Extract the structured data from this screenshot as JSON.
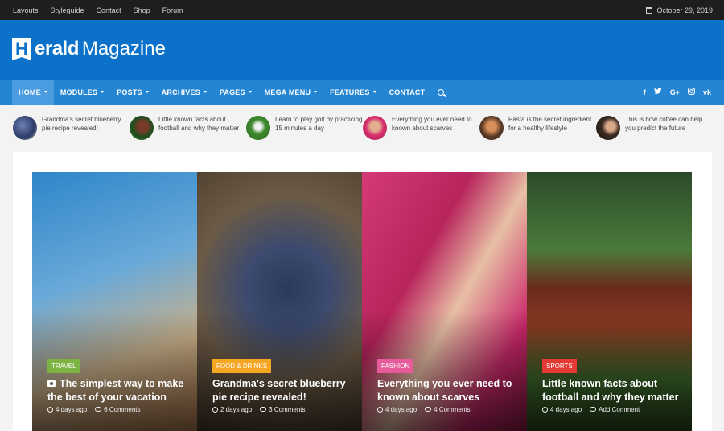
{
  "topbar": {
    "links": [
      "Layouts",
      "Styleguide",
      "Contact",
      "Shop",
      "Forum"
    ],
    "date": "October 29, 2019"
  },
  "logo": {
    "mark": "H",
    "bold": "erald",
    "light": "Magazine"
  },
  "nav": {
    "items": [
      {
        "label": "HOME",
        "dropdown": true
      },
      {
        "label": "MODULES",
        "dropdown": true
      },
      {
        "label": "POSTS",
        "dropdown": true
      },
      {
        "label": "ARCHIVES",
        "dropdown": true
      },
      {
        "label": "PAGES",
        "dropdown": true
      },
      {
        "label": "MEGA MENU",
        "dropdown": true
      },
      {
        "label": "FEATURES",
        "dropdown": true
      },
      {
        "label": "CONTACT",
        "dropdown": false
      }
    ],
    "social": [
      "f",
      "t",
      "G+",
      "ig",
      "vk"
    ]
  },
  "mini_posts": [
    {
      "text": "Grandma's secret blueberry pie recipe revealed!"
    },
    {
      "text": "Little known facts about football and why they matter"
    },
    {
      "text": "Learn to play golf by practicing 15 minutes a day"
    },
    {
      "text": "Everything you ever need to known about scarves"
    },
    {
      "text": "Pasta is the secret ingredient for a healthy lifestyle"
    },
    {
      "text": "This is how coffee can help you predict the future"
    }
  ],
  "featured": [
    {
      "category": "TRAVEL",
      "title": "The simplest way to make the best of your vacation",
      "date": "4 days ago",
      "comments": "6 Comments",
      "has_camera_icon": true
    },
    {
      "category": "FOOD & DRINKS",
      "title": "Grandma's secret blueberry pie recipe revealed!",
      "date": "2 days ago",
      "comments": "3 Comments",
      "has_camera_icon": false
    },
    {
      "category": "FASHION",
      "title": "Everything you ever need to known about scarves",
      "date": "4 days ago",
      "comments": "4 Comments",
      "has_camera_icon": false
    },
    {
      "category": "SPORTS",
      "title": "Little known facts about football and why they matter",
      "date": "4 days ago",
      "comments": "Add Comment",
      "has_camera_icon": false
    }
  ],
  "colors": {
    "header": "#0c72c9",
    "nav": "#2485d3",
    "nav_active": "#4a9be0",
    "topbar": "#1e1e1e",
    "cat_travel": "#7cb342",
    "cat_food": "#f5a623",
    "cat_fashion": "#e85b9a",
    "cat_sports": "#e53935"
  }
}
